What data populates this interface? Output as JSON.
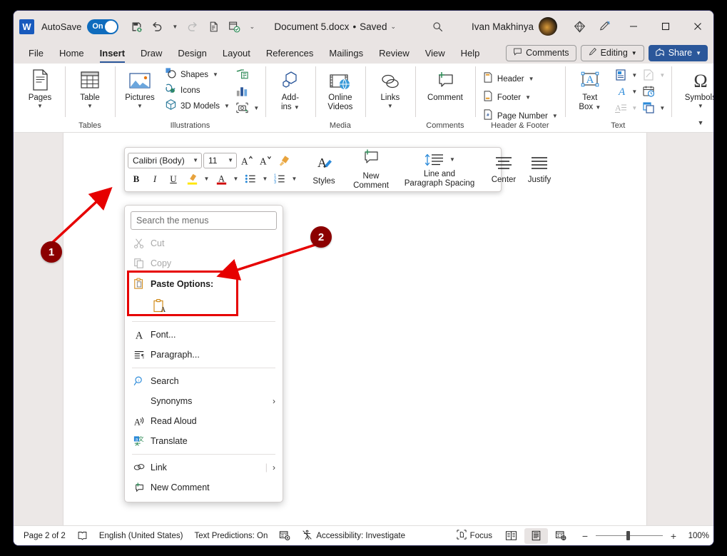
{
  "titlebar": {
    "app_icon": "word-logo",
    "autosave_label": "AutoSave",
    "autosave_state": "On",
    "quick_access": [
      {
        "name": "save-icon",
        "label": "Save"
      },
      {
        "name": "undo-icon",
        "label": "Undo"
      },
      {
        "name": "undo-caret-icon",
        "label": "Undo options"
      },
      {
        "name": "redo-icon",
        "label": "Redo"
      },
      {
        "name": "print-preview-icon",
        "label": "Print Preview and Print"
      },
      {
        "name": "editor-check-icon",
        "label": "Editor"
      },
      {
        "name": "customize-qat-caret-icon",
        "label": "Customize Quick Access Toolbar"
      }
    ],
    "document_title": "Document 5.docx",
    "save_state": "Saved",
    "search_icon": "search-icon",
    "user_name": "Ivan Makhinya",
    "avatar": "user-avatar",
    "diamond_icon": "microsoft-365-diamond-icon",
    "pen_icon": "ink-pen-icon",
    "window_minimize": "minimize-icon",
    "window_maximize": "maximize-icon",
    "window_close": "close-icon"
  },
  "tabs": [
    {
      "label": "File",
      "active": false
    },
    {
      "label": "Home",
      "active": false
    },
    {
      "label": "Insert",
      "active": true
    },
    {
      "label": "Draw",
      "active": false
    },
    {
      "label": "Design",
      "active": false
    },
    {
      "label": "Layout",
      "active": false
    },
    {
      "label": "References",
      "active": false
    },
    {
      "label": "Mailings",
      "active": false
    },
    {
      "label": "Review",
      "active": false
    },
    {
      "label": "View",
      "active": false
    },
    {
      "label": "Help",
      "active": false
    }
  ],
  "tabbar_right": {
    "comments_label": "Comments",
    "editing_label": "Editing",
    "share_label": "Share"
  },
  "ribbon": {
    "groups": [
      {
        "name": "pages",
        "label": "",
        "buttons": [
          {
            "label": "Pages",
            "icon": "page-icon",
            "caret": true
          }
        ]
      },
      {
        "name": "tables",
        "label": "Tables",
        "buttons": [
          {
            "label": "Table",
            "icon": "table-icon",
            "caret": true
          }
        ]
      },
      {
        "name": "illustrations",
        "label": "Illustrations",
        "buttons": [
          {
            "label": "Pictures",
            "icon": "pictures-icon",
            "caret": true
          }
        ],
        "small_items": [
          {
            "label": "Shapes",
            "icon": "shapes-icon",
            "caret": true
          },
          {
            "label": "Icons",
            "icon": "icons-icon",
            "caret": false
          },
          {
            "label": "3D Models",
            "icon": "3d-models-icon",
            "caret": true
          }
        ],
        "icon_items": [
          {
            "icon": "smartart-icon",
            "caret": false
          },
          {
            "icon": "chart-icon",
            "caret": false
          },
          {
            "icon": "screenshot-icon",
            "caret": true
          }
        ]
      },
      {
        "name": "add-ins",
        "label": "",
        "buttons": [
          {
            "label": "Add-ins",
            "icon": "add-ins-icon",
            "caret": true
          }
        ]
      },
      {
        "name": "media",
        "label": "Media",
        "buttons": [
          {
            "label": "Online Videos",
            "icon": "online-video-icon",
            "caret": false
          }
        ]
      },
      {
        "name": "links",
        "label": "",
        "buttons": [
          {
            "label": "Links",
            "icon": "links-icon",
            "caret": true
          }
        ]
      },
      {
        "name": "comments",
        "label": "Comments",
        "buttons": [
          {
            "label": "Comment",
            "icon": "new-comment-icon",
            "caret": false
          }
        ]
      },
      {
        "name": "header-footer",
        "label": "Header & Footer",
        "small_items": [
          {
            "label": "Header",
            "icon": "header-icon",
            "caret": true
          },
          {
            "label": "Footer",
            "icon": "footer-icon",
            "caret": true
          },
          {
            "label": "Page Number",
            "icon": "page-number-icon",
            "caret": true
          }
        ]
      },
      {
        "name": "text",
        "label": "Text",
        "buttons": [
          {
            "label": "Text Box",
            "icon": "text-box-icon",
            "caret": true
          }
        ],
        "icon_items": [
          {
            "icon": "quick-parts-icon",
            "caret": true
          },
          {
            "icon": "wordart-icon",
            "caret": true
          },
          {
            "icon": "drop-cap-icon",
            "caret": true
          },
          {
            "icon": "signature-line-icon",
            "caret": true
          },
          {
            "icon": "date-time-icon",
            "caret": false
          },
          {
            "icon": "object-icon",
            "caret": true
          }
        ]
      },
      {
        "name": "symbols",
        "label": "",
        "buttons": [
          {
            "label": "Symbols",
            "icon": "omega-symbol-icon",
            "caret": true
          }
        ]
      }
    ],
    "collapse_icon": "ribbon-collapse-caret-icon"
  },
  "mini_toolbar": {
    "font_name": "Calibri (Body)",
    "font_size": "11",
    "grow_font": "increase-font-size-icon",
    "shrink_font": "decrease-font-size-icon",
    "format_painter": "format-painter-icon",
    "styles_label": "Styles",
    "styles_icon": "styles-icon",
    "bold": "B",
    "italic": "I",
    "underline": "U",
    "highlight": "text-highlight-icon",
    "font_color": "font-color-icon",
    "bullets": "bullets-icon",
    "numbering": "numbering-icon",
    "new_comment_label": "New Comment",
    "new_comment_icon": "new-comment-icon",
    "line_spacing_label": "Line and Paragraph Spacing",
    "line_spacing_icon": "line-spacing-icon",
    "center_label": "Center",
    "center_icon": "align-center-icon",
    "justify_label": "Justify",
    "justify_icon": "align-justify-icon"
  },
  "context_menu": {
    "search_placeholder": "Search the menus",
    "items": [
      {
        "label": "Cut",
        "icon": "cut-scissors-icon",
        "disabled": true,
        "accel": "t",
        "submenu": false
      },
      {
        "label": "Copy",
        "icon": "copy-icon",
        "disabled": true,
        "accel": "C",
        "submenu": false
      }
    ],
    "paste": {
      "label": "Paste Options:",
      "icon": "paste-clipboard-icon",
      "options": [
        {
          "icon": "keep-text-only-icon",
          "label": "Keep Text Only"
        }
      ]
    },
    "items_after": [
      {
        "label": "Font...",
        "icon": "font-a-icon",
        "disabled": false,
        "submenu": false
      },
      {
        "label": "Paragraph...",
        "icon": "paragraph-icon",
        "disabled": false,
        "submenu": false
      },
      {
        "divider": true
      },
      {
        "label": "Search",
        "icon": "search-magnifier-icon",
        "disabled": false,
        "submenu": false
      },
      {
        "label": "Synonyms",
        "icon": "",
        "disabled": false,
        "submenu": true
      },
      {
        "label": "Read Aloud",
        "icon": "read-aloud-icon",
        "disabled": false,
        "submenu": false
      },
      {
        "label": "Translate",
        "icon": "translate-icon",
        "disabled": false,
        "submenu": false
      },
      {
        "divider": true
      },
      {
        "label": "Link",
        "icon": "link-icon",
        "disabled": false,
        "submenu": true
      },
      {
        "label": "New Comment",
        "icon": "new-comment-icon",
        "disabled": false,
        "submenu": false
      }
    ]
  },
  "annotations": [
    {
      "number": "1",
      "color": "#8b0000"
    },
    {
      "number": "2",
      "color": "#8b0000"
    }
  ],
  "statusbar": {
    "page_info": "Page 2 of 2",
    "word_count_icon": "proofing-icon",
    "language": "English (United States)",
    "text_predictions": "Text Predictions: On",
    "dictate_icon": "editor-score-icon",
    "accessibility": "Accessibility: Investigate",
    "focus_label": "Focus",
    "focus_icon": "focus-mode-icon",
    "view_read_icon": "read-mode-icon",
    "view_print_icon": "print-layout-icon",
    "view_web_icon": "web-layout-icon",
    "zoom_out": "−",
    "zoom_in": "+",
    "zoom_level": "100%"
  }
}
